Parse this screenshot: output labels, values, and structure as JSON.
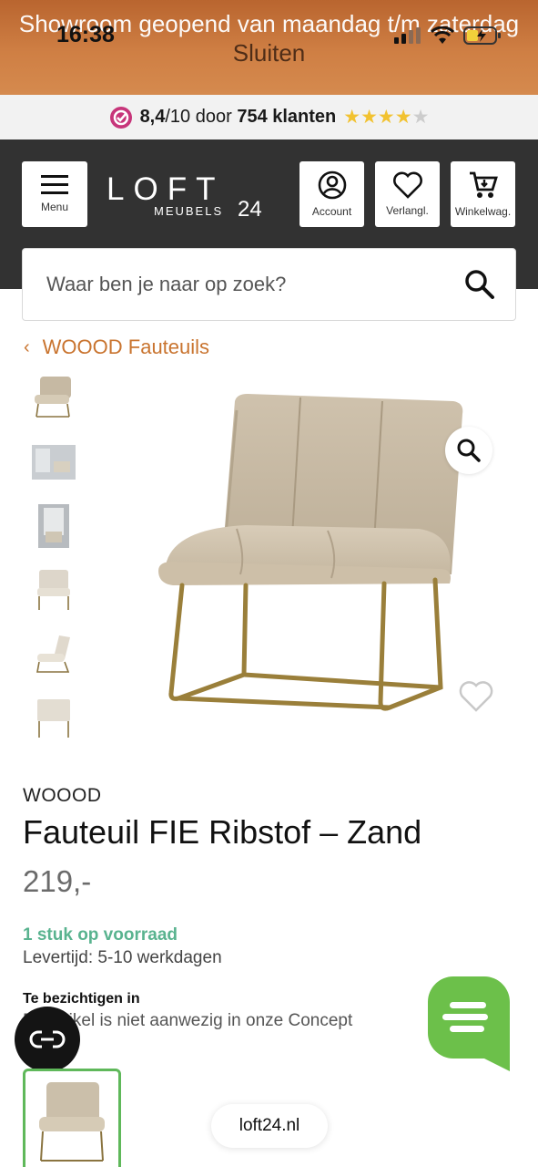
{
  "status_bar": {
    "time": "16:38"
  },
  "banner": {
    "text": "Showroom geopend van maandag t/m zaterdag",
    "close_label": "Sluiten"
  },
  "rating": {
    "score": "8,4",
    "scale": "/10 door",
    "customers": "754 klanten",
    "stars_filled": 4,
    "stars_total": 5
  },
  "header": {
    "menu_label": "Menu",
    "logo_text": "LOFT",
    "logo_sub": "MEUBELS",
    "logo_num": "24",
    "account_label": "Account",
    "wishlist_label": "Verlangl.",
    "cart_label": "Winkelwag."
  },
  "search": {
    "placeholder": "Waar ben je naar op zoek?"
  },
  "breadcrumb": {
    "label": "WOOOD Fauteuils"
  },
  "product": {
    "brand": "WOOOD",
    "title": "Fauteuil FIE Ribstof – Zand",
    "price": "219,-",
    "stock": "1 stuk op voorraad",
    "lead_time": "Levertijd: 5-10 werkdagen",
    "viewing_title": "Te bezichtigen in",
    "viewing_note": "Dit artikel is niet aanwezig in onze Concept"
  },
  "footer": {
    "url": "loft24.nl"
  },
  "colors": {
    "banner": "#cf7f44",
    "header_bg": "#323232",
    "accent_orange": "#c9742f",
    "stock_green": "#59b38f",
    "chat_green": "#6cc04a",
    "star": "#f2c230"
  }
}
